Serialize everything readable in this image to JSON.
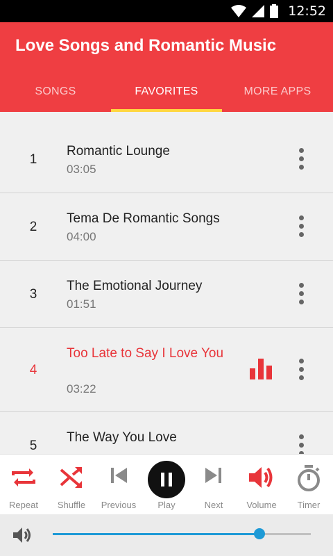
{
  "status_bar": {
    "time": "12:52"
  },
  "app": {
    "title": "Love Songs and Romantic Music"
  },
  "tabs": [
    {
      "label": "SONGS"
    },
    {
      "label": "FAVORITES"
    },
    {
      "label": "MORE APPS"
    }
  ],
  "active_tab": "FAVORITES",
  "songs": [
    {
      "number": "1",
      "title": "Romantic Lounge",
      "duration": "03:05"
    },
    {
      "number": "2",
      "title": "Tema De Romantic Songs",
      "duration": "04:00"
    },
    {
      "number": "3",
      "title": "The Emotional Journey",
      "duration": "01:51"
    },
    {
      "number": "4",
      "title": "Too Late to Say I Love You",
      "duration": "03:22",
      "playing": true
    },
    {
      "number": "5",
      "title": "The Way You Love",
      "duration": ""
    }
  ],
  "controls": {
    "repeat": "Repeat",
    "shuffle": "Shuffle",
    "previous": "Previous",
    "play": "Play",
    "next": "Next",
    "volume": "Volume",
    "timer": "Timer"
  },
  "volume_level": 0.8,
  "colors": {
    "accent": "#ef3e42",
    "tab_indicator": "#ffd740",
    "slider": "#1e9ad6"
  }
}
